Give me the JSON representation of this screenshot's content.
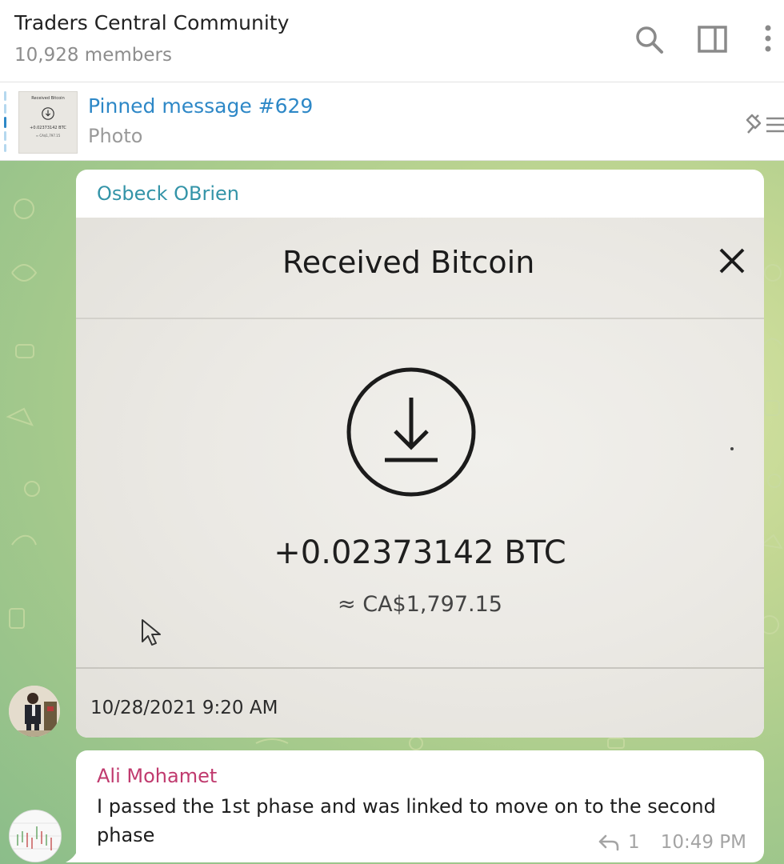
{
  "header": {
    "title": "Traders Central Community",
    "subtitle": "10,928 members",
    "icons": [
      "search-icon",
      "sidebar-toggle-icon",
      "more-vertical-icon"
    ]
  },
  "pinned": {
    "title": "Pinned message #629",
    "subtitle": "Photo",
    "thumb_title": "Received Bitcoin",
    "thumb_amount": "+0.02373142 BTC",
    "thumb_fiat": "≈ CA$1,797.15",
    "icon": "pinned-list-icon"
  },
  "messages": [
    {
      "sender": "Osbeck OBrien",
      "sender_color": "#3494a8",
      "photo": {
        "title": "Received Bitcoin",
        "amount": "+0.02373142 BTC",
        "fiat": "≈ CA$1,797.15",
        "date": "10/28/2021 9:20 AM"
      }
    },
    {
      "sender": "Ali Mohamet",
      "sender_color": "#c03a6e",
      "text": "I passed the 1st phase and was linked to move on to the second phase",
      "replies": "1",
      "time": "10:49 PM"
    }
  ]
}
